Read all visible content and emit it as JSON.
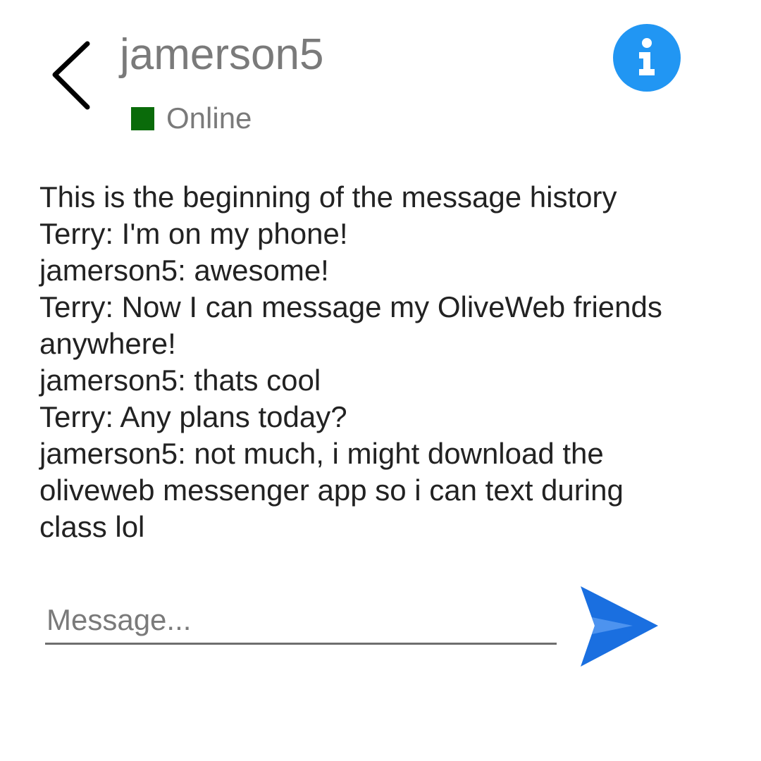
{
  "header": {
    "back_icon": "chevron-left-icon",
    "contact_name": "jamerson5",
    "status_label": "Online",
    "status_color": "#0a6b0a",
    "info_icon": "info-icon",
    "info_color": "#2196f3"
  },
  "history": {
    "intro": "This is the beginning of the message history",
    "messages": [
      "Terry: I'm on my phone!",
      "jamerson5: awesome!",
      "Terry: Now I can message my OliveWeb friends anywhere!",
      "jamerson5: thats cool",
      "Terry: Any plans today?",
      "jamerson5: not much, i might download the oliveweb messenger app so i can text during class lol"
    ]
  },
  "composer": {
    "placeholder": "Message...",
    "value": "",
    "send_icon": "send-icon",
    "send_color": "#1a6fe0"
  }
}
